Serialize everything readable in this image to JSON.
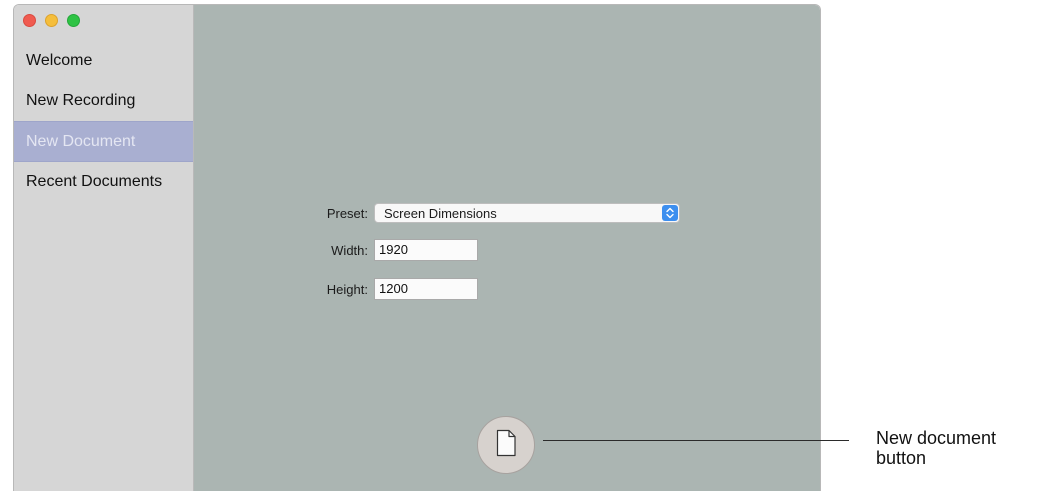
{
  "window": {
    "controls": [
      "close",
      "minimize",
      "zoom"
    ]
  },
  "sidebar": {
    "items": [
      {
        "label": "Welcome",
        "selected": false
      },
      {
        "label": "New Recording",
        "selected": false
      },
      {
        "label": "New Document",
        "selected": true
      },
      {
        "label": "Recent Documents",
        "selected": false
      }
    ]
  },
  "form": {
    "preset_label": "Preset:",
    "preset_value": "Screen Dimensions",
    "width_label": "Width:",
    "width_value": "1920",
    "height_label": "Height:",
    "height_value": "1200"
  },
  "new_document_button": {
    "icon": "document-icon"
  },
  "callout": {
    "line1": "New document",
    "line2": "button"
  },
  "colors": {
    "sidebar_bg": "#d6d6d6",
    "main_bg": "#abb5b2",
    "selection": "#a9afd1",
    "accent": "#3d8fef"
  }
}
